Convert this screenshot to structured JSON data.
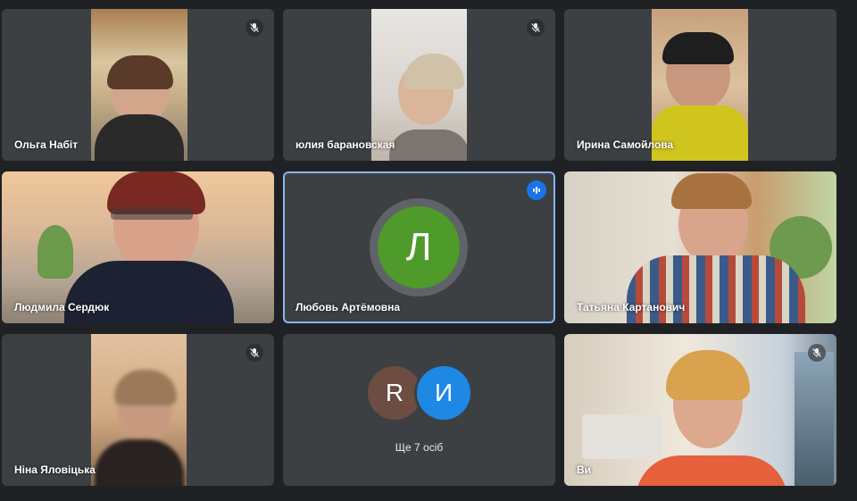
{
  "participants": [
    {
      "name": "Ольга Набіт",
      "muted": true
    },
    {
      "name": "юлия барановская",
      "muted": true
    },
    {
      "name": "Ирина Самойлова",
      "muted": false
    },
    {
      "name": "Людмила Сердюк",
      "muted": false
    },
    {
      "name": "Любовь Артёмовна",
      "muted": false,
      "speaking": true,
      "initial": "Л",
      "avatar_color": "#4e9a2a"
    },
    {
      "name": "Татьяна Картанович",
      "muted": false
    },
    {
      "name": "Ніна Яловіцька",
      "muted": true
    },
    {
      "name": "Ви",
      "muted": true
    }
  ],
  "others": {
    "label": "Ще 7 осіб",
    "avatars": [
      {
        "initial": "R",
        "color": "#6d4c41"
      },
      {
        "initial": "И",
        "color": "#1e88e5"
      }
    ]
  },
  "icons": {
    "muted": "mic-off-icon",
    "speaking": "audio-level-icon"
  },
  "colors": {
    "background": "#202124",
    "tile": "#3c4043",
    "active_border": "#8ab4f8",
    "speaking_badge": "#1a73e8"
  }
}
